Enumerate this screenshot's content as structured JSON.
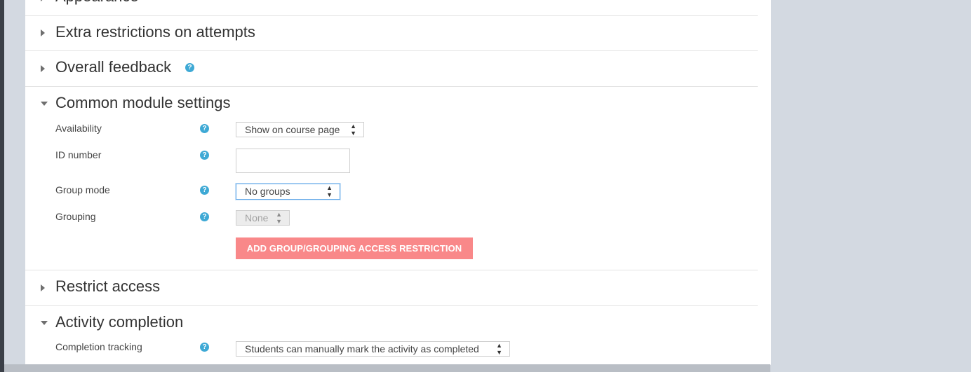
{
  "sections": {
    "appearance": "Appearance",
    "extra_restrictions": "Extra restrictions on attempts",
    "overall_feedback": "Overall feedback",
    "common_module_settings": "Common module settings",
    "restrict_access": "Restrict access",
    "activity_completion": "Activity completion"
  },
  "fields": {
    "availability": {
      "label": "Availability",
      "value": "Show on course page"
    },
    "id_number": {
      "label": "ID number",
      "value": ""
    },
    "group_mode": {
      "label": "Group mode",
      "value": "No groups"
    },
    "grouping": {
      "label": "Grouping",
      "value": "None"
    },
    "completion_tracking": {
      "label": "Completion tracking",
      "value": "Students can manually mark the activity as completed"
    }
  },
  "buttons": {
    "add_restriction": "ADD GROUP/GROUPING ACCESS RESTRICTION"
  },
  "icons": {
    "help": "?",
    "select_arrows": "▲▼"
  },
  "colors": {
    "accent_button": "#f98889",
    "help_icon": "#3ea9d5",
    "focus_border": "#5fa7e8"
  }
}
